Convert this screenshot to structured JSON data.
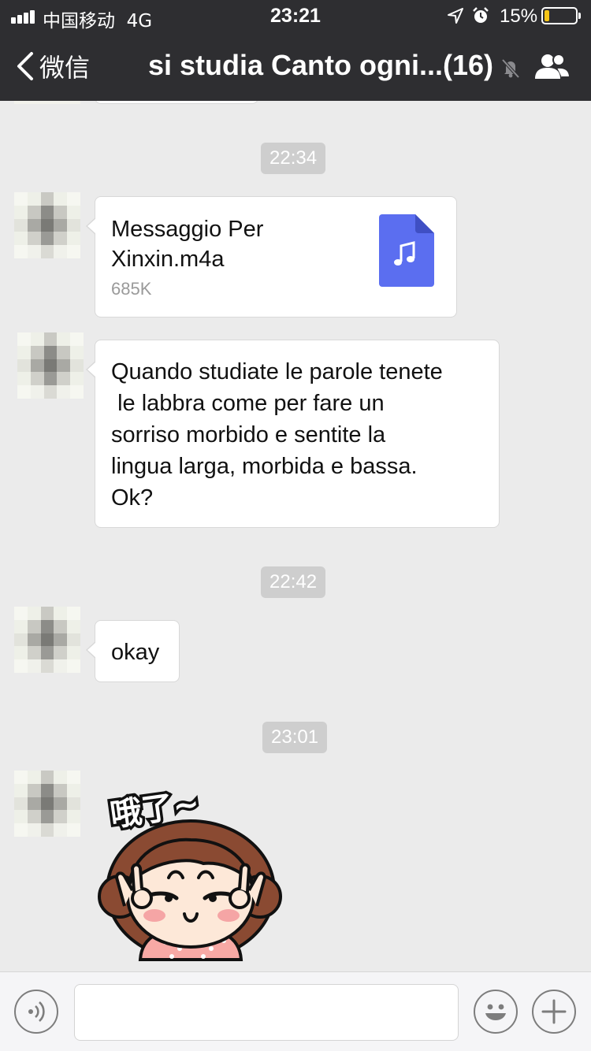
{
  "status_bar": {
    "carrier": "中国移动",
    "network": "4G",
    "time": "23:21",
    "battery_percent": "15%",
    "battery_level": 0.15,
    "battery_color": "#f5c518",
    "icons": [
      "signal-icon",
      "location-arrow-icon",
      "alarm-clock-icon",
      "battery-icon"
    ]
  },
  "nav": {
    "back_label": "微信",
    "title": "si studia Canto ogni...(16)",
    "icons": [
      "back-chevron-icon",
      "mute-bell-icon",
      "group-members-icon"
    ]
  },
  "messages": [
    {
      "type": "time",
      "text": "22:34"
    },
    {
      "type": "file",
      "file_name": "Messaggio Per Xinxin.m4a",
      "file_size": "685K",
      "icon": "music-file-icon",
      "icon_color": "#5b6ef0"
    },
    {
      "type": "text",
      "text": "Quando studiate le parole tenete\n le labbra come per fare un\nsorriso morbido e sentite la\nlingua larga, morbida e bassa.\nOk?"
    },
    {
      "type": "time",
      "text": "22:42"
    },
    {
      "type": "text",
      "text": "okay"
    },
    {
      "type": "time",
      "text": "23:01"
    },
    {
      "type": "sticker",
      "text": "哦了~"
    }
  ],
  "input_bar": {
    "placeholder": "",
    "icons": [
      "voice-icon",
      "emoji-icon",
      "plus-icon"
    ]
  },
  "colors": {
    "top_bar": "#2e2e31",
    "chat_background": "#ebebeb",
    "time_badge": "#cecece",
    "bubble": "#ffffff"
  }
}
